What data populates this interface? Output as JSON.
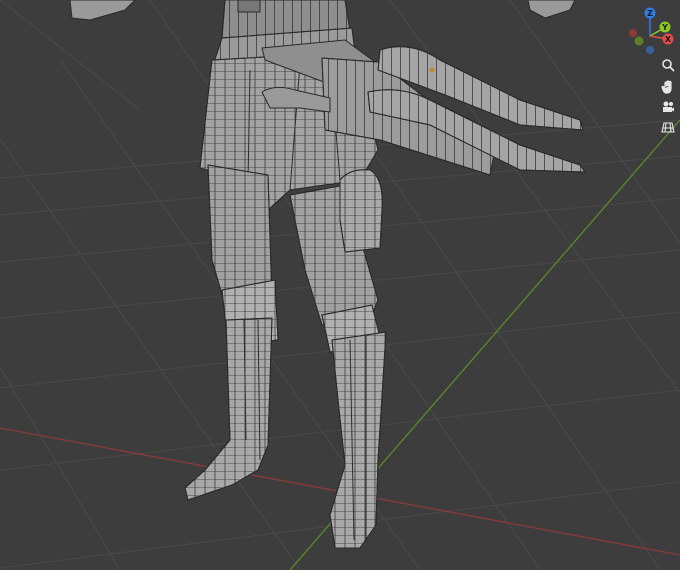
{
  "viewport": {
    "background": "#3d3d3d",
    "grid_line_color": "#4a4a4a",
    "x_axis_color": "#8b3a3a",
    "y_axis_color": "#5a8a2a",
    "wire_color": "#2a2a2a",
    "mesh_color": "#9e9e9e"
  },
  "gizmo": {
    "axes": [
      {
        "label": "Z",
        "color": "#2f7dea"
      },
      {
        "label": "Y",
        "color": "#8ac926"
      },
      {
        "label": "X",
        "color": "#e04c4c"
      }
    ],
    "negative_axes": [
      {
        "color": "#3a5f9e"
      },
      {
        "color": "#5f7e2a"
      },
      {
        "color": "#8f3a3a"
      }
    ]
  },
  "nav_tools": [
    {
      "name": "zoom-icon"
    },
    {
      "name": "pan-hand-icon"
    },
    {
      "name": "camera-view-icon"
    },
    {
      "name": "perspective-grid-icon"
    }
  ]
}
